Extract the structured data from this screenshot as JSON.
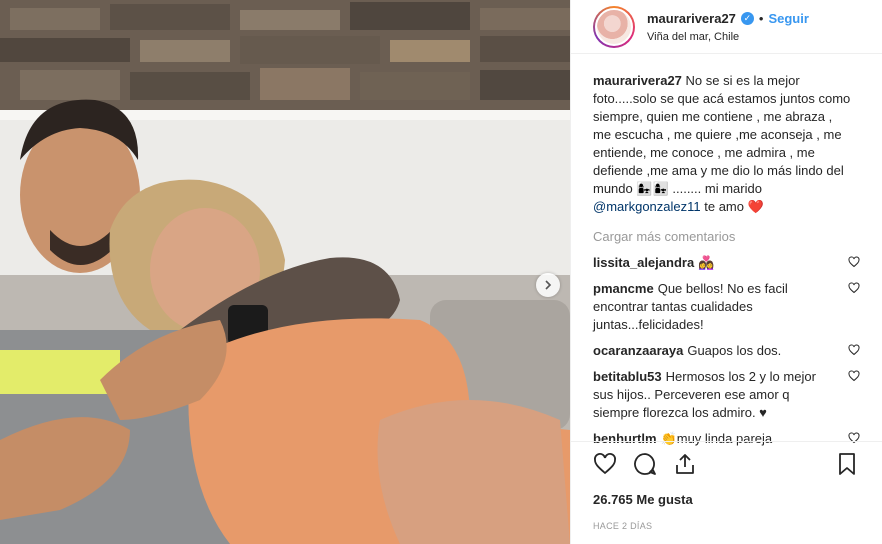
{
  "post": {
    "username": "maurarivera27",
    "follow_label": "Seguir",
    "separator": "•",
    "location": "Viña del mar, Chile",
    "verified_icon": "verified-badge-icon",
    "caption_user": "maurarivera27",
    "caption_text": "No se si es la mejor foto.....solo se que acá estamos juntos como siempre, quien me contiene , me abraza , me escucha , me quiere ,me aconseja , me entiende, me conoce , me admira , me defiende ,me ama y me dio lo más lindo del mundo",
    "caption_emoji": "👩‍👧👩‍👧",
    "caption_tail": "........ mi marido",
    "caption_mention": "@markgonzalez11",
    "caption_end": "te amo",
    "caption_heart": "❤️",
    "load_more": "Cargar más comentarios",
    "comments": [
      {
        "user": "lissita_alejandra",
        "text": "👩‍❤️‍👩"
      },
      {
        "user": "pmancme",
        "text": "Que bellos! No es facil encontrar tantas cualidades juntas...felicidades!"
      },
      {
        "user": "ocaranzaaraya",
        "text": "Guapos los dos."
      },
      {
        "user": "betitablu53",
        "text": "Hermosos los 2 y lo mejor sus hijos.. Perceveren ese amor q siempre florezca los admiro. ♥"
      },
      {
        "user": "benhurtlm",
        "text": "👏muy linda pareja"
      }
    ],
    "likes": "26.765 Me gusta",
    "time": "HACE 2 DÍAS"
  },
  "colors": {
    "accent": "#3897f0",
    "text": "#262626",
    "muted": "#999999",
    "border": "#efefef",
    "heart": "#ed4956"
  }
}
